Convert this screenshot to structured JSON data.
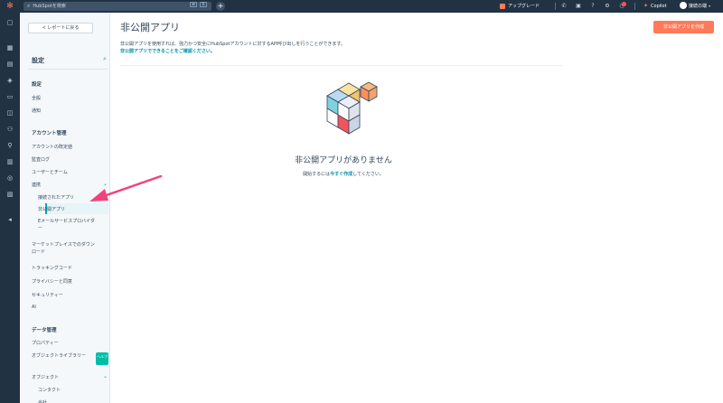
{
  "topbar": {
    "search_placeholder": "HubSpotを検索",
    "kbd_1": "⌘",
    "kbd_2": "K",
    "upgrade_label": "アップグレード",
    "copilot_label": "Copilot",
    "account_name": "接続の端"
  },
  "sidebar": {
    "back_label": "< レポートに戻る",
    "title": "設定",
    "section_personal": "設定",
    "personal_items": [
      "全般",
      "通知"
    ],
    "section_account": "アカウント管理",
    "account_items": [
      "アカウントの既定値",
      "監査ログ",
      "ユーザーとチーム"
    ],
    "integrations_label": "連携",
    "integration_items": [
      "接続されたアプリ",
      "非公開アプリ",
      "Eメールサービスプロバイダー"
    ],
    "more_items": [
      "マーケットプレイスでのダウンロード",
      "トラッキングコード",
      "プライバシーと同意",
      "セキュリティー",
      "AI"
    ],
    "section_data": "データ管理",
    "data_items": [
      "プロパティー",
      "オブジェクトライブラリー"
    ],
    "objects_label": "オブジェクト",
    "object_items": [
      "コンタクト",
      "会社"
    ],
    "help_badge": "ヘルプ"
  },
  "main": {
    "title": "非公開アプリ",
    "create_button": "非公開アプリを作成",
    "description": "非公開アプリを使用すれば、強力かつ安全にHubSpotアカウントに対するAPI呼び出しを行うことができます。",
    "description_link": "非公開アプリでできることをご確認ください。",
    "empty_title": "非公開アプリがありません",
    "empty_prefix": "開始するには",
    "empty_link": "今すぐ作成",
    "empty_suffix": "してください。"
  },
  "colors": {
    "nav_dark": "#213343",
    "accent_orange": "#ff7a59",
    "link_teal": "#0091ae",
    "annotation_pink": "#f0437d"
  }
}
